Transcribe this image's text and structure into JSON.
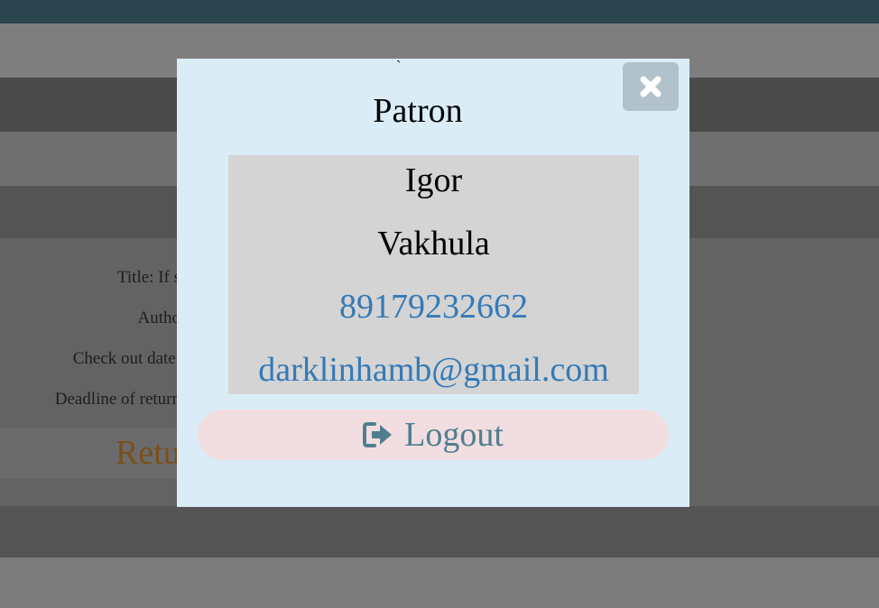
{
  "background": {
    "fields": [
      "Title: If s",
      "Autho",
      "Check out date:",
      "Deadline of return"
    ],
    "return_button": "Retu"
  },
  "modal": {
    "tick": "`",
    "title": "Patron",
    "first_name": "Igor",
    "last_name": "Vakhula",
    "phone": "89179232662",
    "email": "darklinhamb@gmail.com",
    "logout_label": "Logout",
    "close_icon": "close-icon",
    "logout_icon": "sign-out-icon"
  },
  "colors": {
    "modal_bg": "#daedf7",
    "info_bg": "#d4d4d4",
    "link": "#337ab7",
    "logout_bg": "#f2dde0",
    "logout_text": "#4f7f8f",
    "topbar": "#2c464f"
  }
}
